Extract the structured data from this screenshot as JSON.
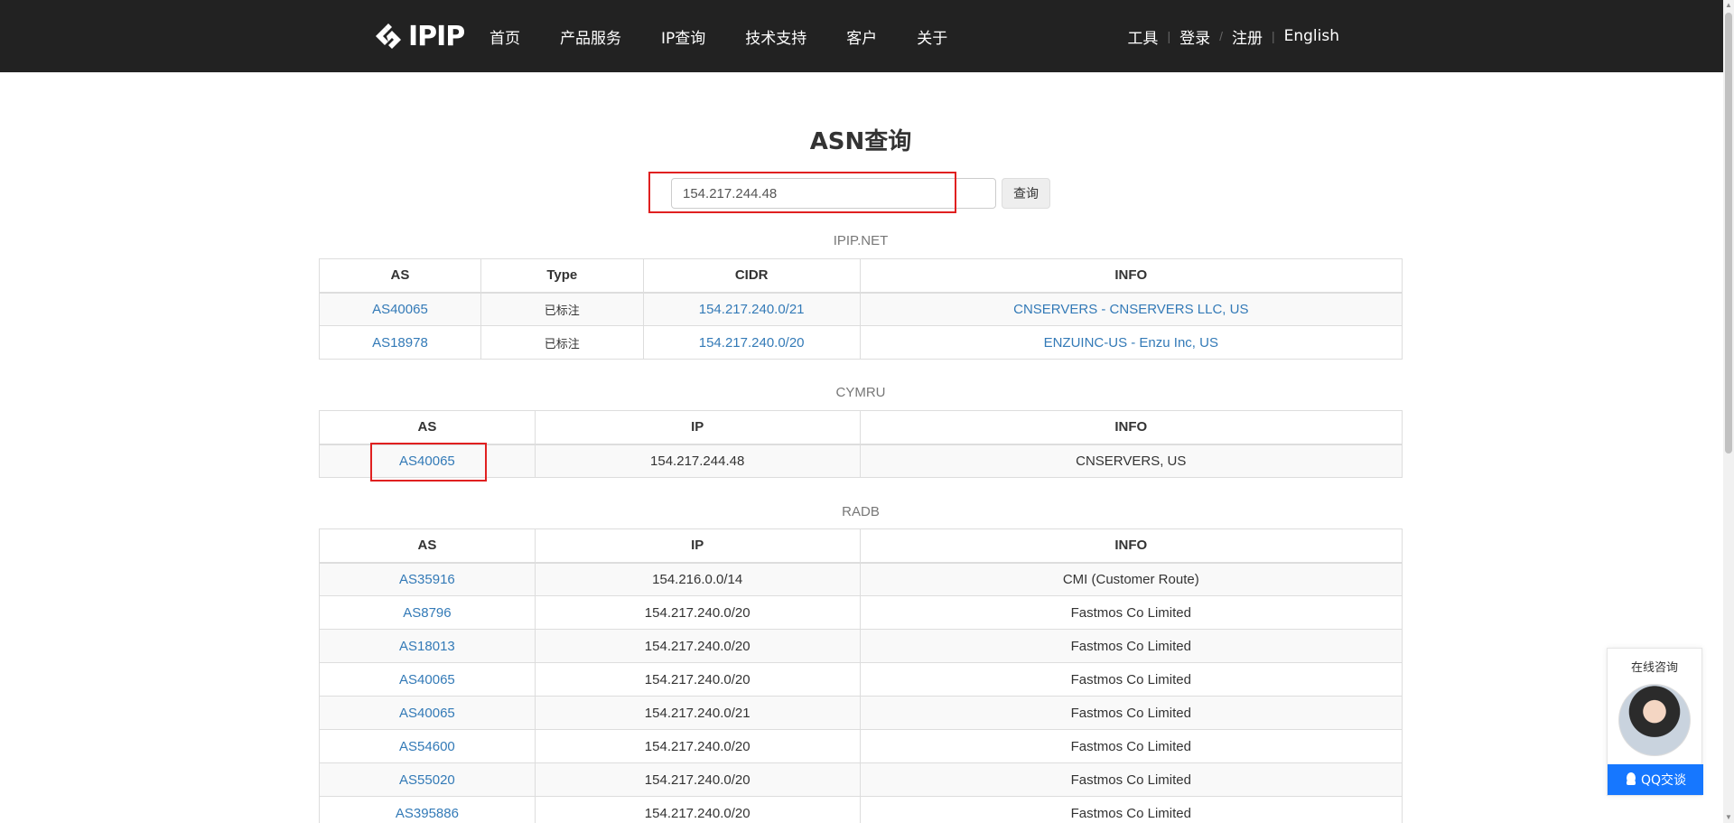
{
  "nav": {
    "logo_text": "IPIP",
    "items": [
      "首页",
      "产品服务",
      "IP查询",
      "技术支持",
      "客户",
      "关于"
    ],
    "right": [
      "工具",
      "登录",
      "注册",
      "English"
    ]
  },
  "page": {
    "title": "ASN查询"
  },
  "search": {
    "value": "154.217.244.48",
    "button_label": "查询"
  },
  "sections": {
    "ipipnet": {
      "caption": "IPIP.NET",
      "headers": [
        "AS",
        "Type",
        "CIDR",
        "INFO"
      ],
      "rows": [
        [
          "AS40065",
          "已标注",
          "154.217.240.0/21",
          "CNSERVERS - CNSERVERS LLC, US"
        ],
        [
          "AS18978",
          "已标注",
          "154.217.240.0/20",
          "ENZUINC-US - Enzu Inc, US"
        ]
      ]
    },
    "cymru": {
      "caption": "CYMRU",
      "headers": [
        "AS",
        "IP",
        "INFO"
      ],
      "rows": [
        [
          "AS40065",
          "154.217.244.48",
          "CNSERVERS, US"
        ]
      ]
    },
    "radb": {
      "caption": "RADB",
      "headers": [
        "AS",
        "IP",
        "INFO"
      ],
      "rows": [
        [
          "AS35916",
          "154.216.0.0/14",
          "CMI (Customer Route)"
        ],
        [
          "AS8796",
          "154.217.240.0/20",
          "Fastmos Co Limited"
        ],
        [
          "AS18013",
          "154.217.240.0/20",
          "Fastmos Co Limited"
        ],
        [
          "AS40065",
          "154.217.240.0/20",
          "Fastmos Co Limited"
        ],
        [
          "AS40065",
          "154.217.240.0/21",
          "Fastmos Co Limited"
        ],
        [
          "AS54600",
          "154.217.240.0/20",
          "Fastmos Co Limited"
        ],
        [
          "AS55020",
          "154.217.240.0/20",
          "Fastmos Co Limited"
        ],
        [
          "AS395886",
          "154.217.240.0/20",
          "Fastmos Co Limited"
        ]
      ]
    }
  },
  "chat": {
    "title": "在线咨询",
    "button_label": "QQ交谈"
  },
  "colors": {
    "nav_bg": "#222222",
    "link": "#337ab7",
    "highlight": "#e02020",
    "chat_button": "#1677ff"
  }
}
